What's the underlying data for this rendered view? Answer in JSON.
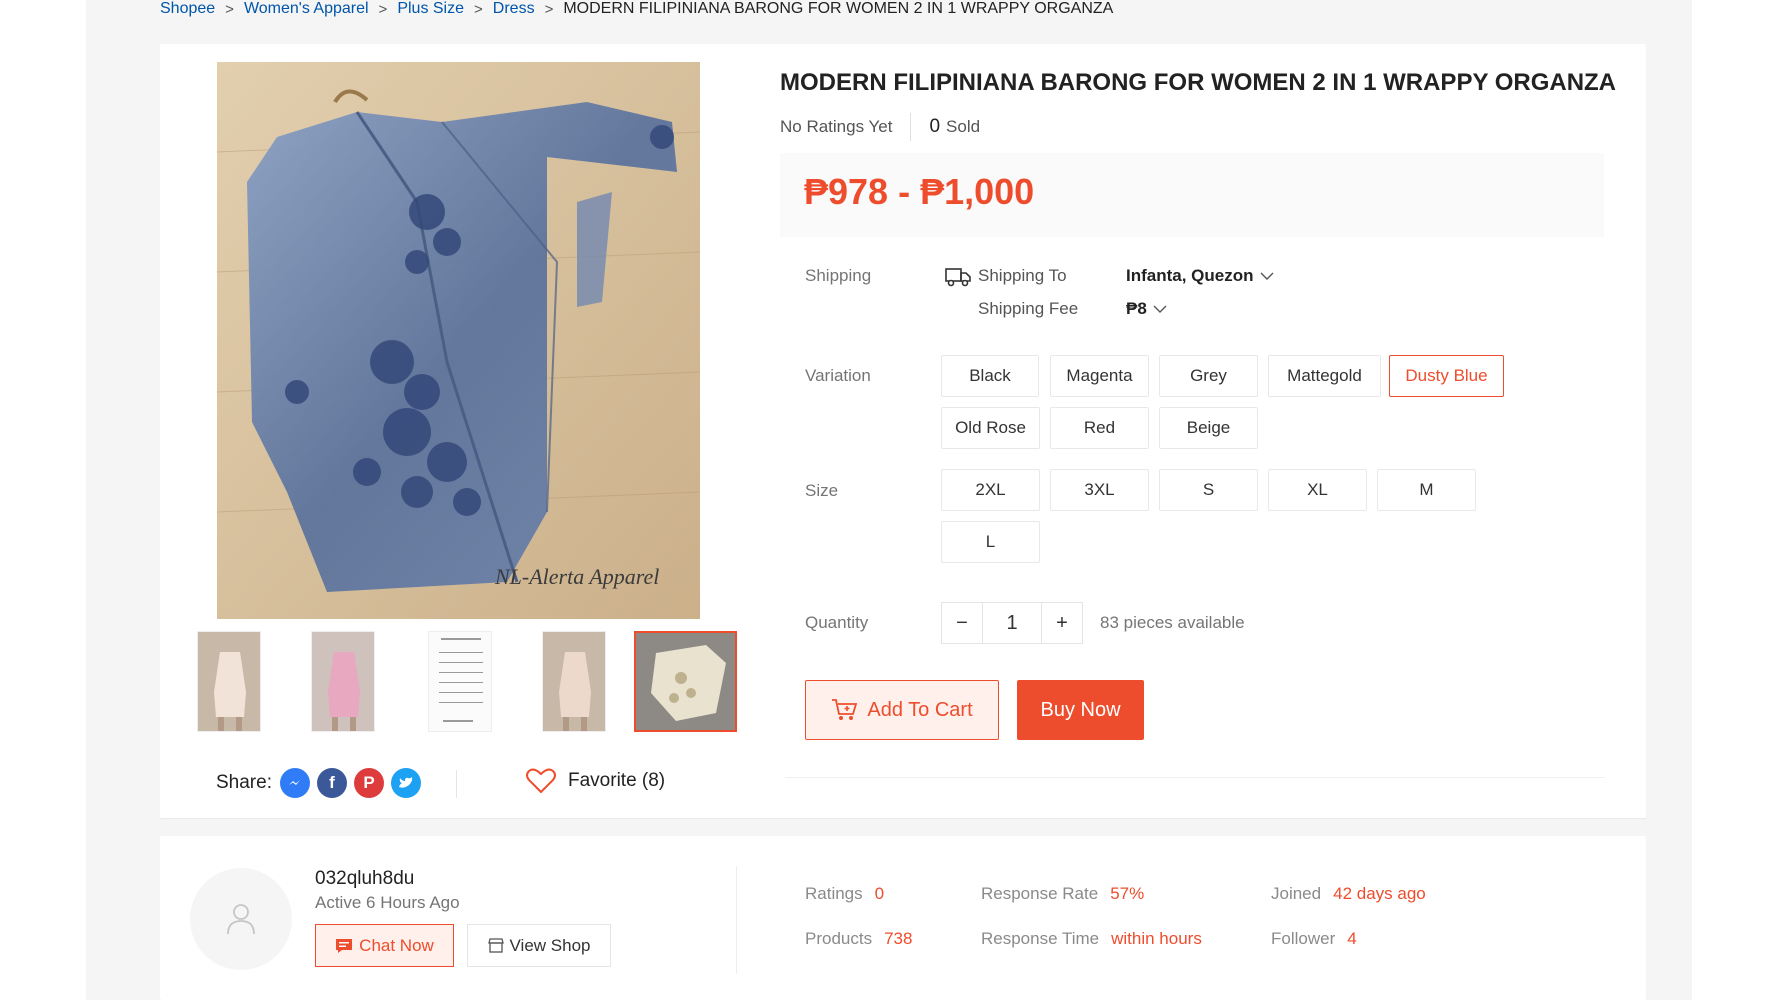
{
  "breadcrumb": {
    "items": [
      "Shopee",
      "Women's Apparel",
      "Plus Size",
      "Dress"
    ],
    "separator": ">",
    "current": "MODERN FILIPINIANA BARONG FOR WOMEN 2 IN 1 WRAPPY ORGANZA"
  },
  "gallery": {
    "main_image_alt": "dusty blue organza barong jacket on wooden floor",
    "watermark": "NL-Alerta Apparel",
    "thumbnails": [
      "thumbnail-1",
      "thumbnail-2",
      "thumbnail-3",
      "thumbnail-4",
      "thumbnail-5"
    ],
    "active_thumbnail_index": 4
  },
  "share": {
    "label": "Share:",
    "icons": [
      "messenger-icon",
      "facebook-icon",
      "pinterest-icon",
      "twitter-icon"
    ]
  },
  "favorite": {
    "label": "Favorite (8)",
    "icon": "heart-icon"
  },
  "product": {
    "title": "MODERN FILIPINIANA BARONG FOR WOMEN 2 IN 1 WRAPPY ORGANZA",
    "ratings": "No Ratings Yet",
    "sold_count": "0",
    "sold_label": "Sold",
    "price": "₱978 - ₱1,000"
  },
  "shipping": {
    "label": "Shipping",
    "to_label": "Shipping To",
    "to_value": "Infanta, Quezon",
    "fee_label": "Shipping Fee",
    "fee_value": "₱8"
  },
  "variation": {
    "label": "Variation",
    "options": [
      "Black",
      "Magenta",
      "Grey",
      "Mattegold",
      "Dusty Blue",
      "Old Rose",
      "Red",
      "Beige"
    ],
    "selected": "Dusty Blue"
  },
  "size": {
    "label": "Size",
    "options": [
      "2XL",
      "3XL",
      "S",
      "XL",
      "M",
      "L"
    ]
  },
  "quantity": {
    "label": "Quantity",
    "value": "1",
    "minus": "−",
    "plus": "+",
    "available": "83 pieces available"
  },
  "actions": {
    "add_to_cart": "Add To Cart",
    "buy_now": "Buy Now"
  },
  "shop": {
    "name": "032qluh8du",
    "active": "Active 6 Hours Ago",
    "chat_now": "Chat Now",
    "view_shop": "View Shop",
    "stats": [
      {
        "key": "Ratings",
        "value": "0"
      },
      {
        "key": "Products",
        "value": "738"
      },
      {
        "key": "Response Rate",
        "value": "57%"
      },
      {
        "key": "Response Time",
        "value": "within hours"
      },
      {
        "key": "Joined",
        "value": "42 days ago"
      },
      {
        "key": "Follower",
        "value": "4"
      }
    ]
  },
  "colors": {
    "accent": "#ee4d2d",
    "link": "#0055aa",
    "background": "#f5f5f5"
  }
}
